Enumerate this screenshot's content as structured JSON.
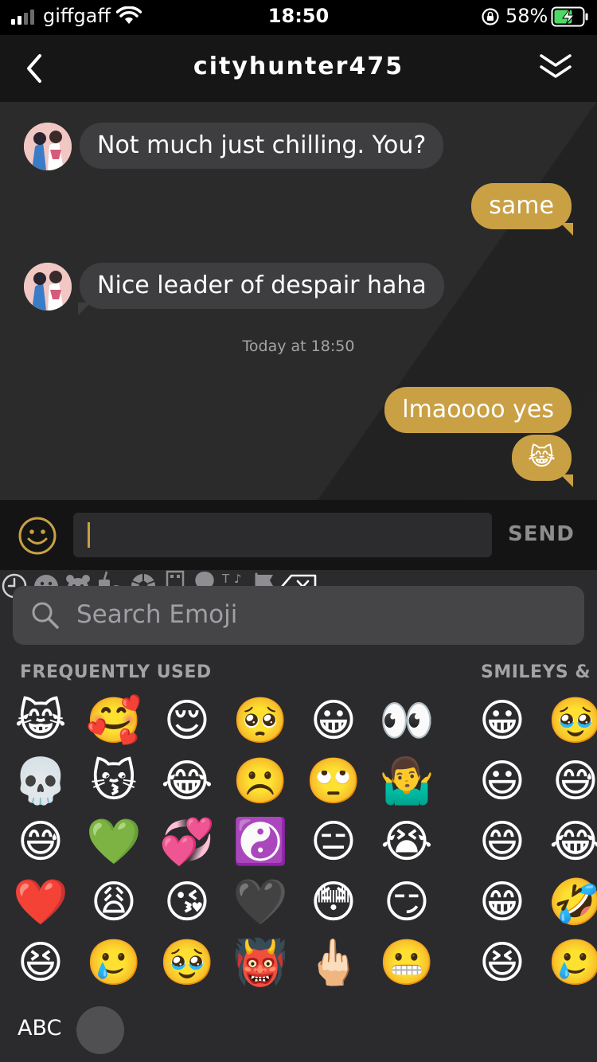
{
  "status_bar": {
    "carrier": "giffgaff",
    "time": "18:50",
    "battery_percent": "58%"
  },
  "header": {
    "title": "cityhunter475"
  },
  "messages": [
    {
      "direction": "incoming",
      "text": "Not much just chilling. You?"
    },
    {
      "direction": "outgoing",
      "text": "same"
    },
    {
      "direction": "incoming",
      "text": "Nice leader of despair haha"
    },
    {
      "direction": "outgoing",
      "text": "lmaoooo yes"
    },
    {
      "direction": "outgoing",
      "text": "😹"
    }
  ],
  "timestamp": "Today at 18:50",
  "composer": {
    "send_label": "SEND",
    "value": ""
  },
  "emoji_keyboard": {
    "search_placeholder": "Search Emoji",
    "sections": [
      "FREQUENTLY USED",
      "SMILEYS & P"
    ],
    "frequent": [
      "😹",
      "🥰",
      "😌",
      "🥺",
      "😀",
      "👀",
      "💀",
      "😽",
      "😂",
      "☹️",
      "🙄",
      "🤷‍♂️",
      "😅",
      "💚",
      "💞",
      "☯️",
      "😑",
      "😭",
      "❤️",
      "😩",
      "😘",
      "🖤",
      "😳",
      "😏",
      "😆",
      "🥲",
      "🥹",
      "👹",
      "🖕🏻",
      "😬"
    ],
    "smileys": [
      "😀",
      "🥹",
      "😃",
      "😅",
      "😄",
      "😂",
      "😁",
      "🤣",
      "😆",
      "🥲"
    ],
    "abc_label": "ABC",
    "categories": [
      "recent-icon",
      "smileys-icon",
      "animals-icon",
      "food-icon",
      "activity-icon",
      "travel-icon",
      "objects-icon",
      "symbols-icon",
      "flags-icon"
    ]
  },
  "colors": {
    "accent": "#c9a044",
    "incoming_bubble": "#3e3e40",
    "background": "#2b2b2b"
  }
}
